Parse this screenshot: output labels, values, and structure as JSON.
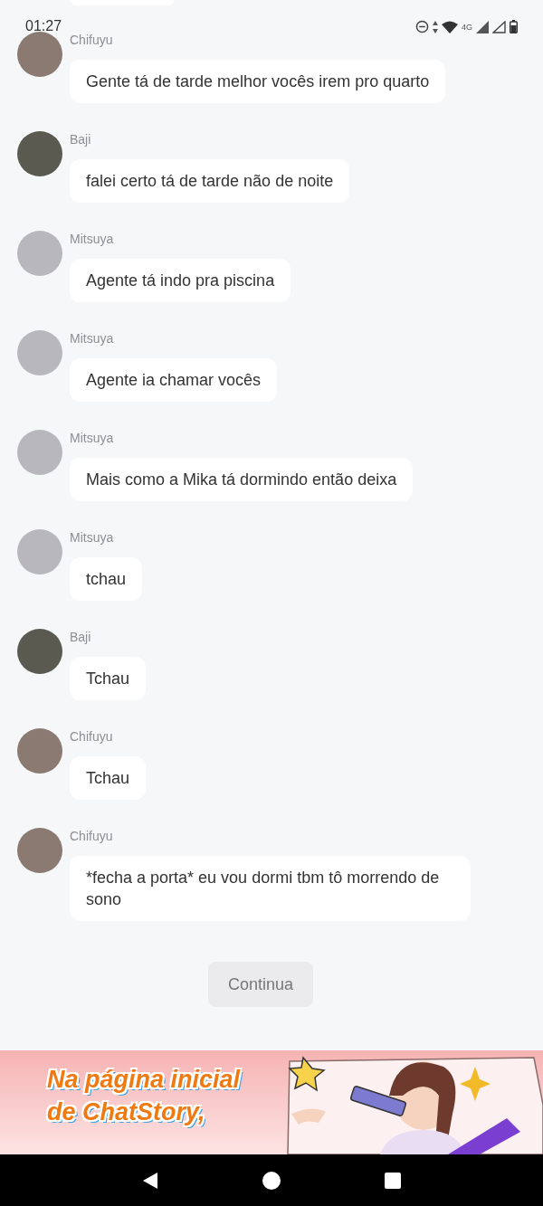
{
  "status_bar": {
    "time": "01:27",
    "network": "4G"
  },
  "messages": [
    {
      "sender": "Chifuyu",
      "color": "#8a7a72",
      "text": "Gente tá de tarde melhor vocês irem pro quarto"
    },
    {
      "sender": "Baji",
      "color": "#5a5a50",
      "text": "falei certo tá de tarde não de noite"
    },
    {
      "sender": "Mitsuya",
      "color": "#b8b8bc",
      "text": "Agente tá indo pra piscina"
    },
    {
      "sender": "Mitsuya",
      "color": "#b8b8bc",
      "text": "Agente ia chamar vocês"
    },
    {
      "sender": "Mitsuya",
      "color": "#b8b8bc",
      "text": "Mais como a Mika tá dormindo então deixa"
    },
    {
      "sender": "Mitsuya",
      "color": "#b8b8bc",
      "text": "tchau"
    },
    {
      "sender": "Baji",
      "color": "#5a5a50",
      "text": "Tchau"
    },
    {
      "sender": "Chifuyu",
      "color": "#8a7a72",
      "text": "Tchau"
    },
    {
      "sender": "Chifuyu",
      "color": "#8a7a72",
      "text": "*fecha a porta* eu vou dormi tbm tô morrendo de sono"
    }
  ],
  "continue_button": "Continua",
  "banner": {
    "kind": "picture",
    "headline": "Na página inicial de ChatStory,"
  }
}
